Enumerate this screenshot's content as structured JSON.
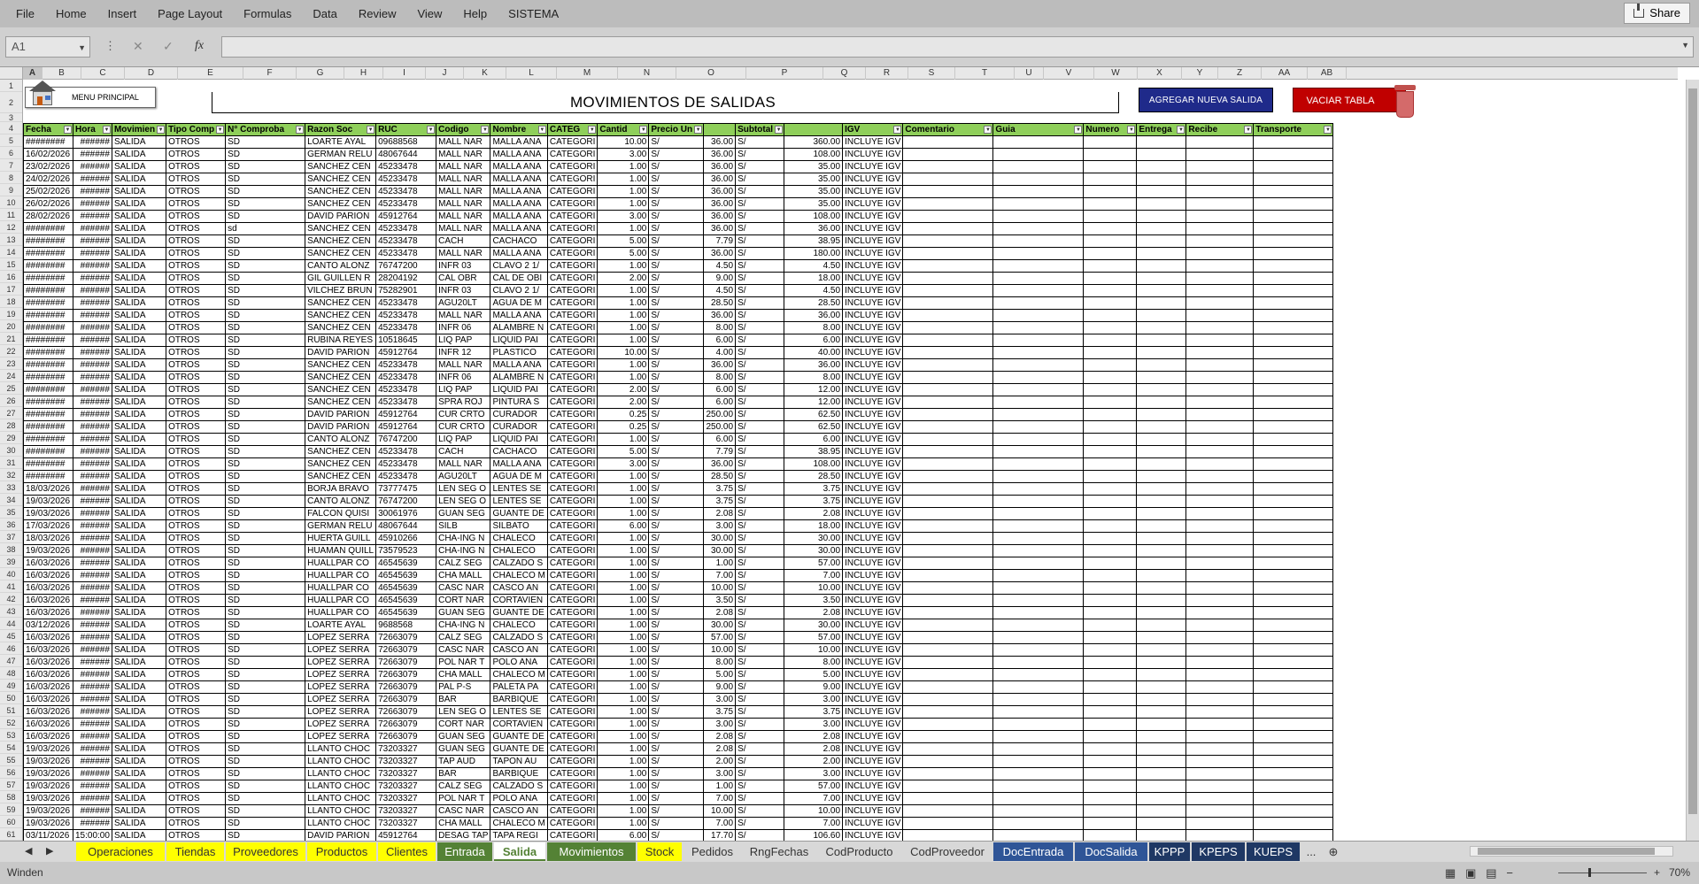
{
  "ribbon": {
    "tabs": [
      "File",
      "Home",
      "Insert",
      "Page Layout",
      "Formulas",
      "Data",
      "Review",
      "View",
      "Help",
      "SISTEMA"
    ],
    "share": "Share"
  },
  "formula_bar": {
    "cell_ref": "A1",
    "fx": "fx",
    "cancel": "✕",
    "confirm": "✓",
    "value": ""
  },
  "columns": [
    "A",
    "B",
    "C",
    "D",
    "E",
    "F",
    "G",
    "H",
    "I",
    "J",
    "K",
    "L",
    "M",
    "N",
    "O",
    "P",
    "Q",
    "R",
    "S",
    "T",
    "U",
    "V",
    "W",
    "X",
    "Y",
    "Z",
    "AA",
    "AB"
  ],
  "buttons": {
    "menu": "MENU PRINCIPAL",
    "add": "AGREGAR NUEVA SALIDA",
    "clear": "VACIAR TABLA"
  },
  "title": "MOVIMIENTOS DE SALIDAS",
  "headers": [
    "Fecha",
    "Hora",
    "Movimien",
    "Tipo Comp",
    "N° Comproba",
    "Razon Soc",
    "RUC",
    "Codigo",
    "Nombre",
    "CATEG",
    "Cantid",
    "Precio Un",
    "",
    "Subtotal",
    "",
    "IGV",
    "Comentario",
    "Guia",
    "Numero",
    "Entrega",
    "Recibe",
    "Transporte"
  ],
  "rows": [
    [
      "########",
      "######",
      "SALIDA",
      "OTROS",
      "SD",
      "LOARTE AYAL",
      "09688568",
      "MALL NAR",
      "MALLA ANA",
      "CATEGORI",
      "10.00",
      "S/",
      "36.00",
      "S/",
      "360.00",
      "INCLUYE IGV"
    ],
    [
      "16/02/2026",
      "######",
      "SALIDA",
      "OTROS",
      "SD",
      "GERMAN RELU",
      "48067644",
      "MALL NAR",
      "MALLA ANA",
      "CATEGORI",
      "3.00",
      "S/",
      "36.00",
      "S/",
      "108.00",
      "INCLUYE IGV"
    ],
    [
      "23/02/2026",
      "######",
      "SALIDA",
      "OTROS",
      "SD",
      "SANCHEZ CEN",
      "45233478",
      "MALL NAR",
      "MALLA ANA",
      "CATEGORI",
      "1.00",
      "S/",
      "36.00",
      "S/",
      "35.00",
      "INCLUYE IGV"
    ],
    [
      "24/02/2026",
      "######",
      "SALIDA",
      "OTROS",
      "SD",
      "SANCHEZ CEN",
      "45233478",
      "MALL NAR",
      "MALLA ANA",
      "CATEGORI",
      "1.00",
      "S/",
      "36.00",
      "S/",
      "35.00",
      "INCLUYE IGV"
    ],
    [
      "25/02/2026",
      "######",
      "SALIDA",
      "OTROS",
      "SD",
      "SANCHEZ CEN",
      "45233478",
      "MALL NAR",
      "MALLA ANA",
      "CATEGORI",
      "1.00",
      "S/",
      "36.00",
      "S/",
      "35.00",
      "INCLUYE IGV"
    ],
    [
      "26/02/2026",
      "######",
      "SALIDA",
      "OTROS",
      "SD",
      "SANCHEZ CEN",
      "45233478",
      "MALL NAR",
      "MALLA ANA",
      "CATEGORI",
      "1.00",
      "S/",
      "36.00",
      "S/",
      "35.00",
      "INCLUYE IGV"
    ],
    [
      "28/02/2026",
      "######",
      "SALIDA",
      "OTROS",
      "SD",
      "DAVID PARION",
      "45912764",
      "MALL NAR",
      "MALLA ANA",
      "CATEGORI",
      "3.00",
      "S/",
      "36.00",
      "S/",
      "108.00",
      "INCLUYE IGV"
    ],
    [
      "########",
      "######",
      "SALIDA",
      "OTROS",
      "sd",
      "SANCHEZ CEN",
      "45233478",
      "MALL NAR",
      "MALLA ANA",
      "CATEGORI",
      "1.00",
      "S/",
      "36.00",
      "S/",
      "36.00",
      "INCLUYE IGV"
    ],
    [
      "########",
      "######",
      "SALIDA",
      "OTROS",
      "SD",
      "SANCHEZ CEN",
      "45233478",
      "CACH",
      "CACHACO",
      "CATEGORI",
      "5.00",
      "S/",
      "7.79",
      "S/",
      "38.95",
      "INCLUYE IGV"
    ],
    [
      "########",
      "######",
      "SALIDA",
      "OTROS",
      "SD",
      "SANCHEZ CEN",
      "45233478",
      "MALL NAR",
      "MALLA ANA",
      "CATEGORI",
      "5.00",
      "S/",
      "36.00",
      "S/",
      "180.00",
      "INCLUYE IGV"
    ],
    [
      "########",
      "######",
      "SALIDA",
      "OTROS",
      "SD",
      "CANTO ALONZ",
      "76747200",
      "INFR 03",
      "CLAVO 2 1/",
      "CATEGORI",
      "1.00",
      "S/",
      "4.50",
      "S/",
      "4.50",
      "INCLUYE IGV"
    ],
    [
      "########",
      "######",
      "SALIDA",
      "OTROS",
      "SD",
      "GIL GUILLEN R",
      "28204192",
      "CAL OBR",
      "CAL DE OBI",
      "CATEGORI",
      "2.00",
      "S/",
      "9.00",
      "S/",
      "18.00",
      "INCLUYE IGV"
    ],
    [
      "########",
      "######",
      "SALIDA",
      "OTROS",
      "SD",
      "VILCHEZ BRUN",
      "75282901",
      "INFR 03",
      "CLAVO 2 1/",
      "CATEGORI",
      "1.00",
      "S/",
      "4.50",
      "S/",
      "4.50",
      "INCLUYE IGV"
    ],
    [
      "########",
      "######",
      "SALIDA",
      "OTROS",
      "SD",
      "SANCHEZ CEN",
      "45233478",
      "AGU20LT",
      "AGUA DE M",
      "CATEGORI",
      "1.00",
      "S/",
      "28.50",
      "S/",
      "28.50",
      "INCLUYE IGV"
    ],
    [
      "########",
      "######",
      "SALIDA",
      "OTROS",
      "SD",
      "SANCHEZ CEN",
      "45233478",
      "MALL NAR",
      "MALLA ANA",
      "CATEGORI",
      "1.00",
      "S/",
      "36.00",
      "S/",
      "36.00",
      "INCLUYE IGV"
    ],
    [
      "########",
      "######",
      "SALIDA",
      "OTROS",
      "SD",
      "SANCHEZ CEN",
      "45233478",
      "INFR 06",
      "ALAMBRE N",
      "CATEGORI",
      "1.00",
      "S/",
      "8.00",
      "S/",
      "8.00",
      "INCLUYE IGV"
    ],
    [
      "########",
      "######",
      "SALIDA",
      "OTROS",
      "SD",
      "RUBINA REYES",
      "10518645",
      "LIQ PAP",
      "LIQUID PAI",
      "CATEGORI",
      "1.00",
      "S/",
      "6.00",
      "S/",
      "6.00",
      "INCLUYE IGV"
    ],
    [
      "########",
      "######",
      "SALIDA",
      "OTROS",
      "SD",
      "DAVID PARION",
      "45912764",
      "INFR 12",
      "PLASTICO",
      "CATEGORI",
      "10.00",
      "S/",
      "4.00",
      "S/",
      "40.00",
      "INCLUYE IGV"
    ],
    [
      "########",
      "######",
      "SALIDA",
      "OTROS",
      "SD",
      "SANCHEZ CEN",
      "45233478",
      "MALL NAR",
      "MALLA ANA",
      "CATEGORI",
      "1.00",
      "S/",
      "36.00",
      "S/",
      "36.00",
      "INCLUYE IGV"
    ],
    [
      "########",
      "######",
      "SALIDA",
      "OTROS",
      "SD",
      "SANCHEZ CEN",
      "45233478",
      "INFR 06",
      "ALAMBRE N",
      "CATEGORI",
      "1.00",
      "S/",
      "8.00",
      "S/",
      "8.00",
      "INCLUYE IGV"
    ],
    [
      "########",
      "######",
      "SALIDA",
      "OTROS",
      "SD",
      "SANCHEZ CEN",
      "45233478",
      "LIQ PAP",
      "LIQUID PAI",
      "CATEGORI",
      "2.00",
      "S/",
      "6.00",
      "S/",
      "12.00",
      "INCLUYE IGV"
    ],
    [
      "########",
      "######",
      "SALIDA",
      "OTROS",
      "SD",
      "SANCHEZ CEN",
      "45233478",
      "SPRA ROJ",
      "PINTURA S",
      "CATEGORI",
      "2.00",
      "S/",
      "6.00",
      "S/",
      "12.00",
      "INCLUYE IGV"
    ],
    [
      "########",
      "######",
      "SALIDA",
      "OTROS",
      "SD",
      "DAVID PARION",
      "45912764",
      "CUR CRTO",
      "CURADOR",
      "CATEGORI",
      "0.25",
      "S/",
      "250.00",
      "S/",
      "62.50",
      "INCLUYE IGV"
    ],
    [
      "########",
      "######",
      "SALIDA",
      "OTROS",
      "SD",
      "DAVID PARION",
      "45912764",
      "CUR CRTO",
      "CURADOR",
      "CATEGORI",
      "0.25",
      "S/",
      "250.00",
      "S/",
      "62.50",
      "INCLUYE IGV"
    ],
    [
      "########",
      "######",
      "SALIDA",
      "OTROS",
      "SD",
      "CANTO ALONZ",
      "76747200",
      "LIQ PAP",
      "LIQUID PAI",
      "CATEGORI",
      "1.00",
      "S/",
      "6.00",
      "S/",
      "6.00",
      "INCLUYE IGV"
    ],
    [
      "########",
      "######",
      "SALIDA",
      "OTROS",
      "SD",
      "SANCHEZ CEN",
      "45233478",
      "CACH",
      "CACHACO",
      "CATEGORI",
      "5.00",
      "S/",
      "7.79",
      "S/",
      "38.95",
      "INCLUYE IGV"
    ],
    [
      "########",
      "######",
      "SALIDA",
      "OTROS",
      "SD",
      "SANCHEZ CEN",
      "45233478",
      "MALL NAR",
      "MALLA ANA",
      "CATEGORI",
      "3.00",
      "S/",
      "36.00",
      "S/",
      "108.00",
      "INCLUYE IGV"
    ],
    [
      "########",
      "######",
      "SALIDA",
      "OTROS",
      "SD",
      "SANCHEZ CEN",
      "45233478",
      "AGU20LT",
      "AGUA DE M",
      "CATEGORI",
      "1.00",
      "S/",
      "28.50",
      "S/",
      "28.50",
      "INCLUYE IGV"
    ],
    [
      "18/03/2026",
      "######",
      "SALIDA",
      "OTROS",
      "SD",
      "BORJA BRAVO",
      "73777475",
      "LEN SEG O",
      "LENTES SE",
      "CATEGORI",
      "1.00",
      "S/",
      "3.75",
      "S/",
      "3.75",
      "INCLUYE IGV"
    ],
    [
      "19/03/2026",
      "######",
      "SALIDA",
      "OTROS",
      "SD",
      "CANTO ALONZ",
      "76747200",
      "LEN SEG O",
      "LENTES SE",
      "CATEGORI",
      "1.00",
      "S/",
      "3.75",
      "S/",
      "3.75",
      "INCLUYE IGV"
    ],
    [
      "19/03/2026",
      "######",
      "SALIDA",
      "OTROS",
      "SD",
      "FALCON QUISI",
      "30061976",
      "GUAN SEG",
      "GUANTE DE",
      "CATEGORI",
      "1.00",
      "S/",
      "2.08",
      "S/",
      "2.08",
      "INCLUYE IGV"
    ],
    [
      "17/03/2026",
      "######",
      "SALIDA",
      "OTROS",
      "SD",
      "GERMAN RELU",
      "48067644",
      "SILB",
      "SILBATO",
      "CATEGORI",
      "6.00",
      "S/",
      "3.00",
      "S/",
      "18.00",
      "INCLUYE IGV"
    ],
    [
      "18/03/2026",
      "######",
      "SALIDA",
      "OTROS",
      "SD",
      "HUERTA GUILL",
      "45910266",
      "CHA-ING N",
      "CHALECO",
      "CATEGORI",
      "1.00",
      "S/",
      "30.00",
      "S/",
      "30.00",
      "INCLUYE IGV"
    ],
    [
      "19/03/2026",
      "######",
      "SALIDA",
      "OTROS",
      "SD",
      "HUAMAN QUILL",
      "73579523",
      "CHA-ING N",
      "CHALECO",
      "CATEGORI",
      "1.00",
      "S/",
      "30.00",
      "S/",
      "30.00",
      "INCLUYE IGV"
    ],
    [
      "16/03/2026",
      "######",
      "SALIDA",
      "OTROS",
      "SD",
      "HUALLPAR CO",
      "46545639",
      "CALZ SEG",
      "CALZADO S",
      "CATEGORI",
      "1.00",
      "S/",
      "1.00",
      "S/",
      "57.00",
      "INCLUYE IGV"
    ],
    [
      "16/03/2026",
      "######",
      "SALIDA",
      "OTROS",
      "SD",
      "HUALLPAR CO",
      "46545639",
      "CHA MALL",
      "CHALECO M",
      "CATEGORI",
      "1.00",
      "S/",
      "7.00",
      "S/",
      "7.00",
      "INCLUYE IGV"
    ],
    [
      "16/03/2026",
      "######",
      "SALIDA",
      "OTROS",
      "SD",
      "HUALLPAR CO",
      "46545639",
      "CASC NAR",
      "CASCO AN",
      "CATEGORI",
      "1.00",
      "S/",
      "10.00",
      "S/",
      "10.00",
      "INCLUYE IGV"
    ],
    [
      "16/03/2026",
      "######",
      "SALIDA",
      "OTROS",
      "SD",
      "HUALLPAR CO",
      "46545639",
      "CORT NAR",
      "CORTAVIEN",
      "CATEGORI",
      "1.00",
      "S/",
      "3.50",
      "S/",
      "3.50",
      "INCLUYE IGV"
    ],
    [
      "16/03/2026",
      "######",
      "SALIDA",
      "OTROS",
      "SD",
      "HUALLPAR CO",
      "46545639",
      "GUAN SEG",
      "GUANTE DE",
      "CATEGORI",
      "1.00",
      "S/",
      "2.08",
      "S/",
      "2.08",
      "INCLUYE IGV"
    ],
    [
      "03/12/2026",
      "######",
      "SALIDA",
      "OTROS",
      "SD",
      "LOARTE AYAL",
      "9688568",
      "CHA-ING N",
      "CHALECO",
      "CATEGORI",
      "1.00",
      "S/",
      "30.00",
      "S/",
      "30.00",
      "INCLUYE IGV"
    ],
    [
      "16/03/2026",
      "######",
      "SALIDA",
      "OTROS",
      "SD",
      "LOPEZ SERRA",
      "72663079",
      "CALZ SEG",
      "CALZADO S",
      "CATEGORI",
      "1.00",
      "S/",
      "57.00",
      "S/",
      "57.00",
      "INCLUYE IGV"
    ],
    [
      "16/03/2026",
      "######",
      "SALIDA",
      "OTROS",
      "SD",
      "LOPEZ SERRA",
      "72663079",
      "CASC NAR",
      "CASCO AN",
      "CATEGORI",
      "1.00",
      "S/",
      "10.00",
      "S/",
      "10.00",
      "INCLUYE IGV"
    ],
    [
      "16/03/2026",
      "######",
      "SALIDA",
      "OTROS",
      "SD",
      "LOPEZ SERRA",
      "72663079",
      "POL NAR T",
      "POLO ANA",
      "CATEGORI",
      "1.00",
      "S/",
      "8.00",
      "S/",
      "8.00",
      "INCLUYE IGV"
    ],
    [
      "16/03/2026",
      "######",
      "SALIDA",
      "OTROS",
      "SD",
      "LOPEZ SERRA",
      "72663079",
      "CHA MALL",
      "CHALECO M",
      "CATEGORI",
      "1.00",
      "S/",
      "5.00",
      "S/",
      "5.00",
      "INCLUYE IGV"
    ],
    [
      "16/03/2026",
      "######",
      "SALIDA",
      "OTROS",
      "SD",
      "LOPEZ SERRA",
      "72663079",
      "PAL P-S",
      "PALETA PA",
      "CATEGORI",
      "1.00",
      "S/",
      "9.00",
      "S/",
      "9.00",
      "INCLUYE IGV"
    ],
    [
      "16/03/2026",
      "######",
      "SALIDA",
      "OTROS",
      "SD",
      "LOPEZ SERRA",
      "72663079",
      "BAR",
      "BARBIQUE",
      "CATEGORI",
      "1.00",
      "S/",
      "3.00",
      "S/",
      "3.00",
      "INCLUYE IGV"
    ],
    [
      "16/03/2026",
      "######",
      "SALIDA",
      "OTROS",
      "SD",
      "LOPEZ SERRA",
      "72663079",
      "LEN SEG O",
      "LENTES SE",
      "CATEGORI",
      "1.00",
      "S/",
      "3.75",
      "S/",
      "3.75",
      "INCLUYE IGV"
    ],
    [
      "16/03/2026",
      "######",
      "SALIDA",
      "OTROS",
      "SD",
      "LOPEZ SERRA",
      "72663079",
      "CORT NAR",
      "CORTAVIEN",
      "CATEGORI",
      "1.00",
      "S/",
      "3.00",
      "S/",
      "3.00",
      "INCLUYE IGV"
    ],
    [
      "16/03/2026",
      "######",
      "SALIDA",
      "OTROS",
      "SD",
      "LOPEZ SERRA",
      "72663079",
      "GUAN SEG",
      "GUANTE DE",
      "CATEGORI",
      "1.00",
      "S/",
      "2.08",
      "S/",
      "2.08",
      "INCLUYE IGV"
    ],
    [
      "19/03/2026",
      "######",
      "SALIDA",
      "OTROS",
      "SD",
      "LLANTO CHOC",
      "73203327",
      "GUAN SEG",
      "GUANTE DE",
      "CATEGORI",
      "1.00",
      "S/",
      "2.08",
      "S/",
      "2.08",
      "INCLUYE IGV"
    ],
    [
      "19/03/2026",
      "######",
      "SALIDA",
      "OTROS",
      "SD",
      "LLANTO CHOC",
      "73203327",
      "TAP AUD",
      "TAPON AU",
      "CATEGORI",
      "1.00",
      "S/",
      "2.00",
      "S/",
      "2.00",
      "INCLUYE IGV"
    ],
    [
      "19/03/2026",
      "######",
      "SALIDA",
      "OTROS",
      "SD",
      "LLANTO CHOC",
      "73203327",
      "BAR",
      "BARBIQUE",
      "CATEGORI",
      "1.00",
      "S/",
      "3.00",
      "S/",
      "3.00",
      "INCLUYE IGV"
    ],
    [
      "19/03/2026",
      "######",
      "SALIDA",
      "OTROS",
      "SD",
      "LLANTO CHOC",
      "73203327",
      "CALZ SEG",
      "CALZADO S",
      "CATEGORI",
      "1.00",
      "S/",
      "1.00",
      "S/",
      "57.00",
      "INCLUYE IGV"
    ],
    [
      "19/03/2026",
      "######",
      "SALIDA",
      "OTROS",
      "SD",
      "LLANTO CHOC",
      "73203327",
      "POL NAR T",
      "POLO ANA",
      "CATEGORI",
      "1.00",
      "S/",
      "7.00",
      "S/",
      "7.00",
      "INCLUYE IGV"
    ],
    [
      "19/03/2026",
      "######",
      "SALIDA",
      "OTROS",
      "SD",
      "LLANTO CHOC",
      "73203327",
      "CASC NAR",
      "CASCO AN",
      "CATEGORI",
      "1.00",
      "S/",
      "10.00",
      "S/",
      "10.00",
      "INCLUYE IGV"
    ],
    [
      "19/03/2026",
      "######",
      "SALIDA",
      "OTROS",
      "SD",
      "LLANTO CHOC",
      "73203327",
      "CHA MALL",
      "CHALECO M",
      "CATEGORI",
      "1.00",
      "S/",
      "7.00",
      "S/",
      "7.00",
      "INCLUYE IGV"
    ],
    [
      "03/11/2026",
      "15:00:00",
      "SALIDA",
      "OTROS",
      "SD",
      "DAVID PARION",
      "45912764",
      "DESAG TAP",
      "TAPA REGI",
      "CATEGORI",
      "6.00",
      "S/",
      "17.70",
      "S/",
      "106.60",
      "INCLUYE IGV"
    ]
  ],
  "sheet_tabs": [
    {
      "name": "Operaciones",
      "style": "yellow"
    },
    {
      "name": "Tiendas",
      "style": "yellow"
    },
    {
      "name": "Proveedores",
      "style": "yellow"
    },
    {
      "name": "Productos",
      "style": "yellow"
    },
    {
      "name": "Clientes",
      "style": "yellow"
    },
    {
      "name": "Entrada",
      "style": "green"
    },
    {
      "name": "Salida",
      "style": "active"
    },
    {
      "name": "Movimientos",
      "style": "green"
    },
    {
      "name": "Stock",
      "style": "yellow"
    },
    {
      "name": "Pedidos",
      "style": "plain"
    },
    {
      "name": "RngFechas",
      "style": "plain"
    },
    {
      "name": "CodProducto",
      "style": "plain"
    },
    {
      "name": "CodProveedor",
      "style": "plain"
    },
    {
      "name": "DocEntrada",
      "style": "blue"
    },
    {
      "name": "DocSalida",
      "style": "blue"
    },
    {
      "name": "KPPP",
      "style": "navy"
    },
    {
      "name": "KPEPS",
      "style": "navy"
    },
    {
      "name": "KUEPS",
      "style": "navy"
    }
  ],
  "sheet_more": "...",
  "status": {
    "left": "Winden",
    "zoom": "70%"
  },
  "colors": {
    "header_green": "#8fcf5a",
    "add_button": "#1f2a8a",
    "clear_button": "#c00000",
    "ribbon": "#bcbcbc"
  }
}
